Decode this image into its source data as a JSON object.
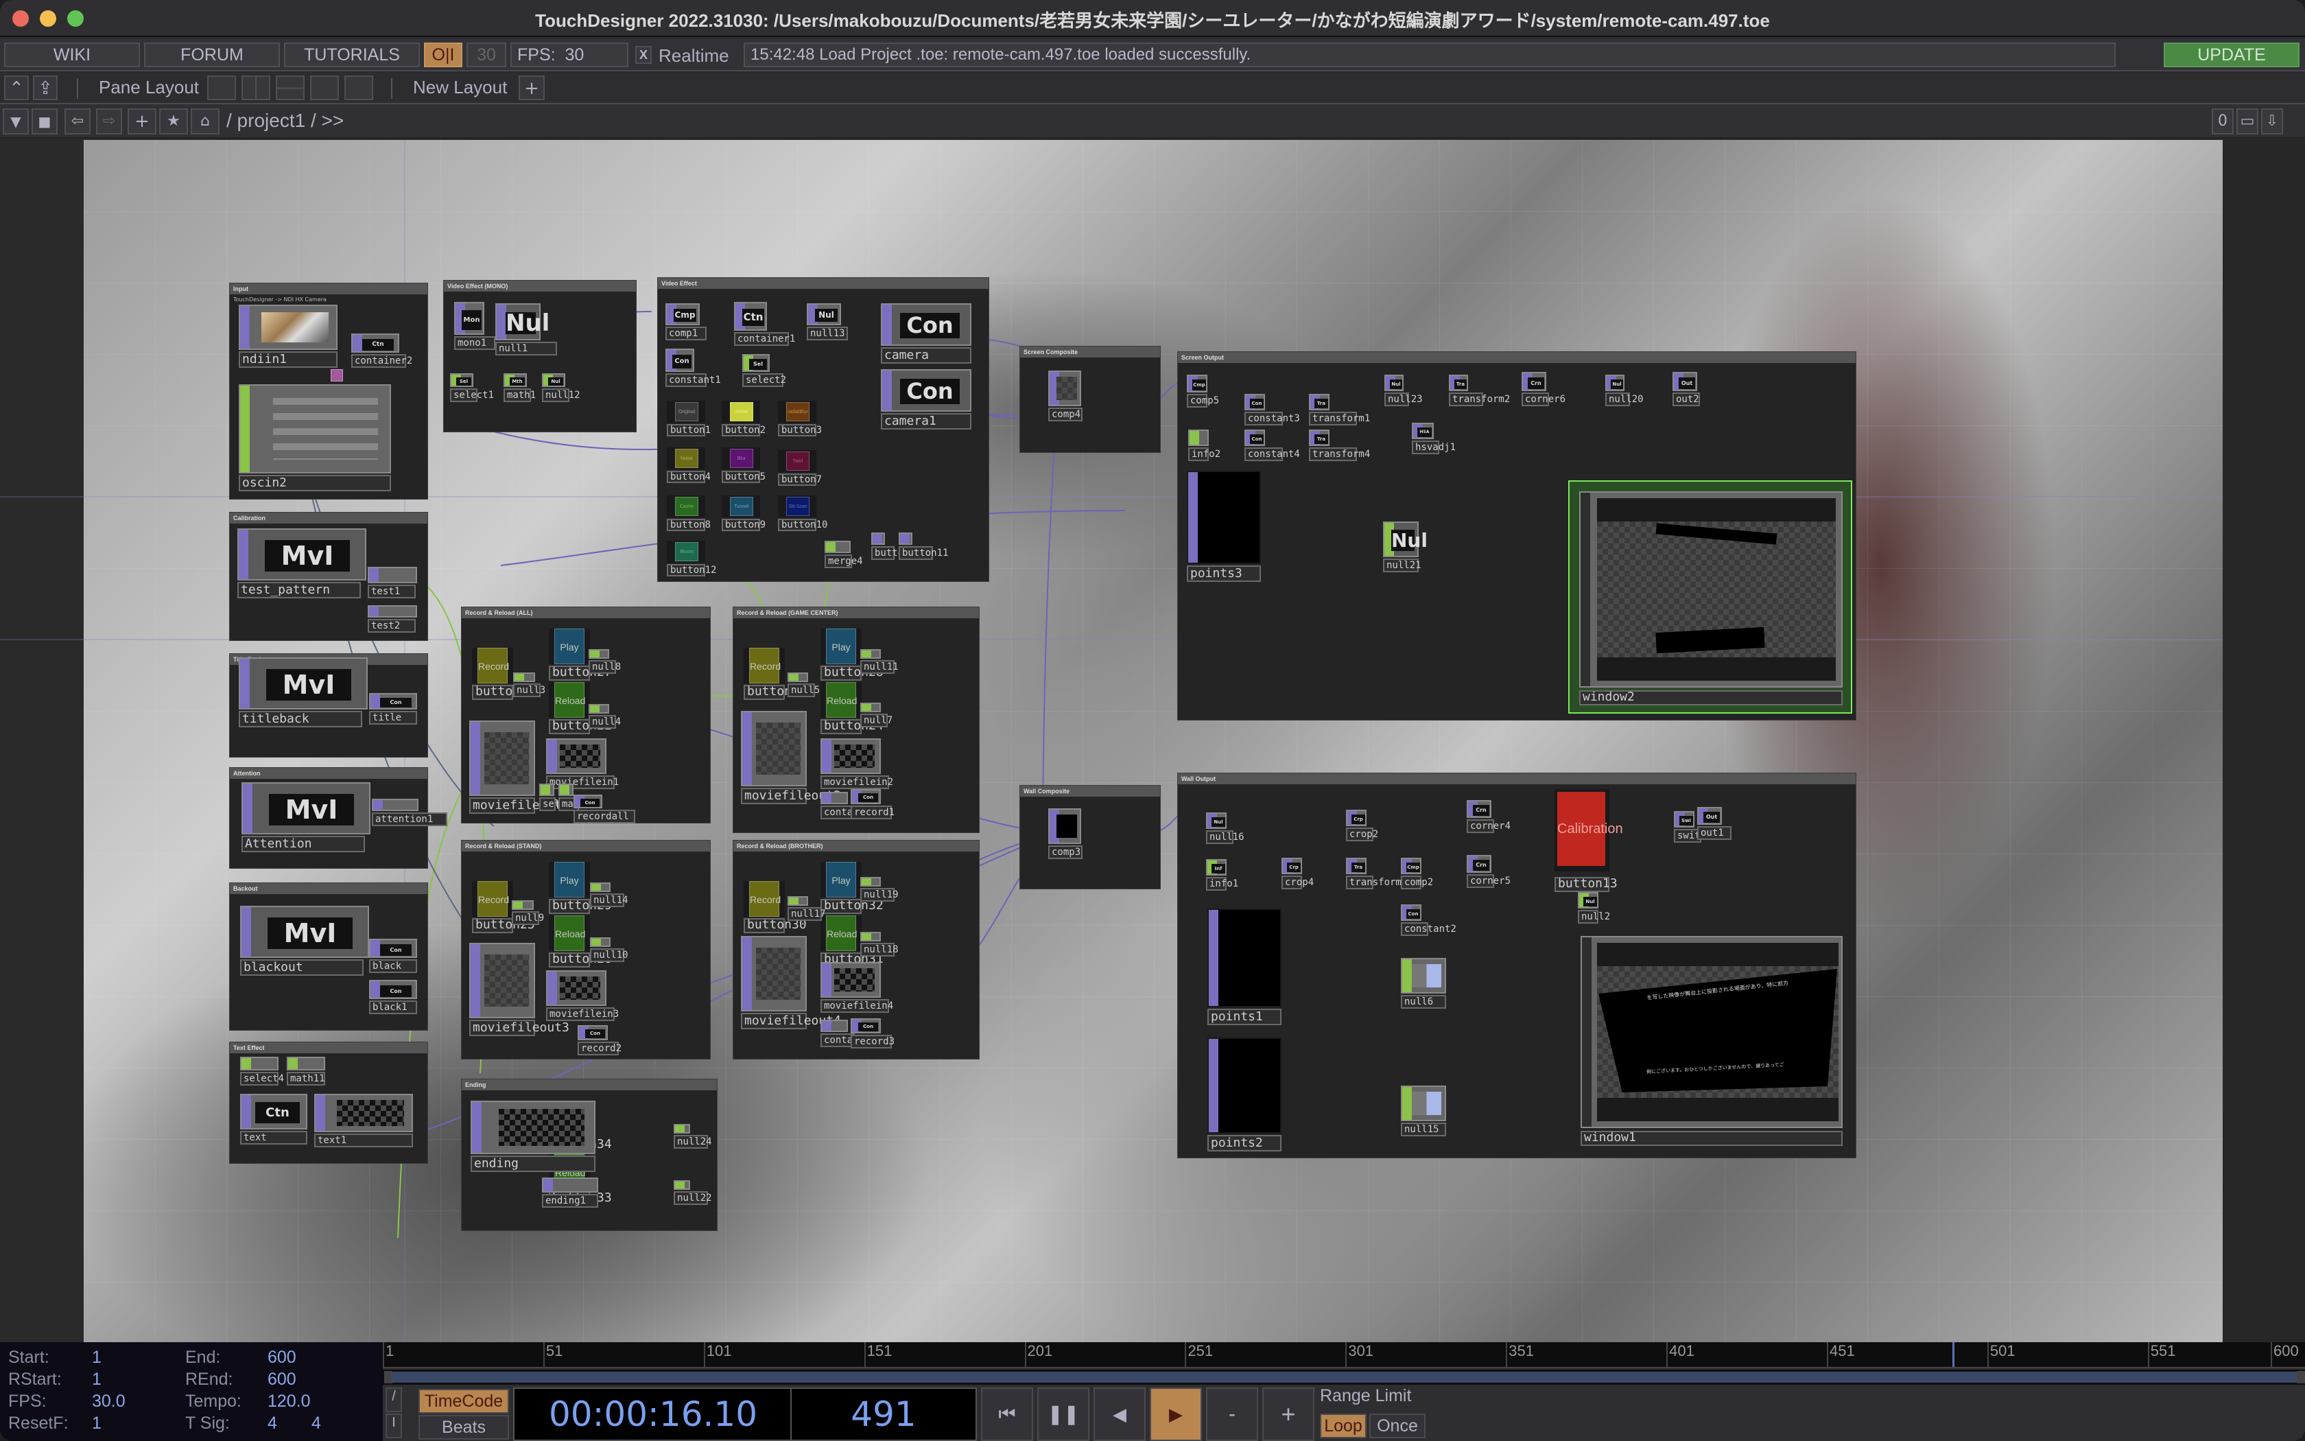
{
  "window": {
    "title": "TouchDesigner 2022.31030: /Users/makobouzu/Documents/老若男女未来学園/シーユレーター/かながわ短編演劇アワード/system/remote-cam.497.toe",
    "traffic_lights": [
      "#ec6a5e",
      "#f4bf4f",
      "#61c554"
    ]
  },
  "topbar": {
    "wiki": "WIKI",
    "forum": "FORUM",
    "tutorials": "TUTORIALS",
    "oi": "O|I",
    "fps_dim": "30",
    "fps_label": "FPS:",
    "fps_value": "30",
    "realtime_check": "X",
    "realtime_label": "Realtime",
    "status": "15:42:48 Load Project .toe: remote-cam.497.toe loaded successfully.",
    "update": "UPDATE"
  },
  "layoutbar": {
    "pane_layout": "Pane Layout",
    "new_layout": "New Layout",
    "plus": "+"
  },
  "pathbar": {
    "path": "/ project1 / >>",
    "right_count": "0"
  },
  "network": {
    "boxes": {
      "input": {
        "title": "Input",
        "subtitle": "TouchDesigner -> NDI HX Camera"
      },
      "video_effect_mono": {
        "title": "Video Effect (MONO)"
      },
      "video_effect": {
        "title": "Video Effect"
      },
      "calibration": {
        "title": "Calibration"
      },
      "title_back": {
        "title": "Title Back"
      },
      "attention": {
        "title": "Attention"
      },
      "backout": {
        "title": "Backout"
      },
      "text_effect": {
        "title": "Text Effect"
      },
      "rr_all": {
        "title": "Record & Reload (ALL)"
      },
      "rr_game": {
        "title": "Record & Reload (GAME CENTER)"
      },
      "rr_stand": {
        "title": "Record & Reload (STAND)"
      },
      "rr_brother": {
        "title": "Record & Reload (BROTHER)"
      },
      "ending": {
        "title": "Ending"
      },
      "screen_composite": {
        "title": "Screen Composite"
      },
      "screen_output": {
        "title": "Screen Output"
      },
      "wall_composite": {
        "title": "Wall Composite"
      },
      "wall_output": {
        "title": "Wall Output"
      }
    },
    "ops": {
      "ndiin1": "ndiin1",
      "container2": "container2",
      "container2_tag": "Ctn",
      "oscin2": "oscin2",
      "mono1": "mono1",
      "mono1_tag": "Mon",
      "null1": "null1",
      "null1_tag": "Nul",
      "select1": "select1",
      "select1_tag": "Sel",
      "math1": "math1",
      "math1_tag": "Mth",
      "null12": "null12",
      "null12_tag": "Nul",
      "comp1": "comp1",
      "comp1_tag": "Cmp",
      "container1": "container1",
      "container1_tag": "Ctn",
      "null13": "null13",
      "null13_tag": "Nul",
      "camera": "camera",
      "camera_tag": "Con",
      "constant1": "constant1",
      "constant1_tag": "Con",
      "select2": "select2",
      "select2_tag": "Sel",
      "camera1": "camera1",
      "camera1_tag": "Con",
      "merge4": "merge4",
      "button6": "button6",
      "button11": "button11",
      "test_pattern": "test_pattern",
      "test_pattern_tag": "MvI",
      "test1": "test1",
      "test2": "test2",
      "titleback": "titleback",
      "titleback_tag": "MvI",
      "title": "title",
      "title_tag": "Con",
      "attention_op": "Attention",
      "attention_tag": "MvI",
      "attention1": "attention1",
      "blackout": "blackout",
      "blackout_tag": "MvI",
      "black": "black",
      "black_tag": "Con",
      "black1": "black1",
      "black1_tag": "Con",
      "select4": "select4",
      "math11": "math11",
      "text": "text",
      "text_tag": "Ctn",
      "text1": "text1",
      "moviefileout1": "moviefileout1",
      "moviefilein1": "moviefilein1",
      "recordall": "recordall",
      "recordall_tag": "Con",
      "select3": "selec",
      "math2": "mat32",
      "null3": "null3",
      "null8": "null8",
      "null4": "null4",
      "moviefileout2": "moviefileout2",
      "moviefilein2": "moviefilein2",
      "container3": "contai",
      "record1": "record1",
      "record1_tag": "Con",
      "null5": "null5",
      "null11": "null11",
      "null7": "null7",
      "moviefileout3": "moviefileout3",
      "moviefilein3": "moviefilein3",
      "record2": "record2",
      "record2_tag": "Con",
      "null9": "null9",
      "null14": "null14",
      "null10": "null10",
      "moviefileout4": "moviefileout4",
      "moviefilein4": "moviefilein4",
      "container4": "contai",
      "record3": "record3",
      "record3_tag": "Con",
      "null17": "null17",
      "null19": "null19",
      "null18": "null18",
      "ending_op": "ending",
      "ending1": "ending1",
      "null24": "null24",
      "null22": "null22",
      "comp4": "comp4",
      "comp5": "comp5",
      "comp5_tag": "Cmp",
      "constant3": "constant3",
      "constant3_tag": "Con",
      "transform1": "transform1",
      "transform1_tag": "Tra",
      "info2": "info2",
      "constant4": "constant4",
      "constant4_tag": "Con",
      "transform4": "transform4",
      "transform4_tag": "Tra",
      "null23": "null23",
      "null23_tag": "Nul",
      "transform2": "transform2",
      "transform2_tag": "Tra",
      "corner6": "corner6",
      "corner6_tag": "Crn",
      "null20": "null20",
      "null20_tag": "Nul",
      "out2": "out2",
      "out2_tag": "Out",
      "hsvadj1": "hsvadj1",
      "hsvadj1_tag": "HSA",
      "points3": "points3",
      "null21": "null21",
      "null21_tag": "Nul",
      "window2": "window2",
      "comp3": "comp3",
      "null16": "null16",
      "null16_tag": "Nul",
      "crop2": "crop2",
      "crop2_tag": "Crp",
      "corner4": "corner4",
      "corner4_tag": "Crn",
      "switch1": "switch1",
      "switch1_tag": "Swi",
      "out1": "out1",
      "out1_tag": "Out",
      "info1": "info1",
      "info1_tag": "Inf",
      "crop4": "crop4",
      "crop4_tag": "Crp",
      "transform3": "transform3",
      "transform3_tag": "Tra",
      "comp2": "comp2",
      "comp2_tag": "Cmp",
      "corner5": "corner5",
      "corner5_tag": "Crn",
      "button13": "button13",
      "null2": "null2",
      "null2_tag": "Nul",
      "constant2": "constant2",
      "constant2_tag": "Con",
      "points1": "points1",
      "null6": "null6",
      "points2": "points2",
      "null15": "null15",
      "window1": "window1"
    },
    "effect_buttons": [
      {
        "name": "button1",
        "label": "Original",
        "color": "#3a3a3a",
        "text": "#9a9a9a"
      },
      {
        "name": "button2",
        "label": "Noise",
        "color": "#c9d23c",
        "text": "#eef08a"
      },
      {
        "name": "button3",
        "label": "radialBlur",
        "color": "#6a3c10",
        "text": "#c28a50"
      },
      {
        "name": "button4",
        "label": "Noise",
        "color": "#6d6d18",
        "text": "#b0b060"
      },
      {
        "name": "button5",
        "label": "Blur",
        "color": "#5c1470",
        "text": "#b070c0"
      },
      {
        "name": "button7",
        "label": "Twirl",
        "color": "#5e1234",
        "text": "#b06080"
      },
      {
        "name": "button8",
        "label": "Cashe",
        "color": "#2a6a22",
        "text": "#70b060"
      },
      {
        "name": "button9",
        "label": "Tunnel",
        "color": "#1c4e6a",
        "text": "#6aa0c0"
      },
      {
        "name": "button10",
        "label": "Slit Scan",
        "color": "#0c1a6a",
        "text": "#6070c0"
      },
      {
        "name": "button12",
        "label": "Bloom",
        "color": "#1e6a4e",
        "text": "#60b090"
      }
    ],
    "record_buttons": {
      "record": "Record",
      "play": "Play",
      "reload": "Reload",
      "record_color": "#6b6b16",
      "play_color": "#1c4f6c",
      "reload_color": "#2f6a1a",
      "all": {
        "record": "button21",
        "play": "button27",
        "reload": "button22"
      },
      "game": {
        "record": "button23",
        "play": "button28",
        "reload": "button24"
      },
      "stand": {
        "record": "button25",
        "play": "button29",
        "reload": "button26"
      },
      "brother": {
        "record": "button30",
        "play": "button32",
        "reload": "button31"
      },
      "ending": {
        "play": "button34",
        "reload": "button33"
      }
    },
    "calibration_button": {
      "label": "Calibration",
      "color": "#c0271e"
    },
    "window1_text_top": "を写した映像が舞台上に投影される場面があり、特に前方",
    "window1_text_bottom": "側にございます。おひとつしかございませんので、譲りあってご"
  },
  "timeline": {
    "start_label": "Start:",
    "start": "1",
    "end_label": "End:",
    "end": "600",
    "rstart_label": "RStart:",
    "rstart": "1",
    "rend_label": "REnd:",
    "rend": "600",
    "fps_label": "FPS:",
    "fps": "30.0",
    "tempo_label": "Tempo:",
    "tempo": "120.0",
    "resetf_label": "ResetF:",
    "resetf": "1",
    "tsig_label": "T Sig:",
    "tsig_num": "4",
    "tsig_den": "4",
    "ticks": [
      "1",
      "51",
      "101",
      "151",
      "201",
      "251",
      "301",
      "351",
      "401",
      "451",
      "501",
      "551",
      "600"
    ],
    "current_frame_fraction": 0.8167,
    "timecode_label": "TimeCode",
    "beats_label": "Beats",
    "timecode": "00:00:16.10",
    "frame": "491",
    "minus": "-",
    "plus": "+",
    "range_limit": "Range Limit",
    "loop": "Loop",
    "once": "Once",
    "accent": "#b9864f"
  }
}
